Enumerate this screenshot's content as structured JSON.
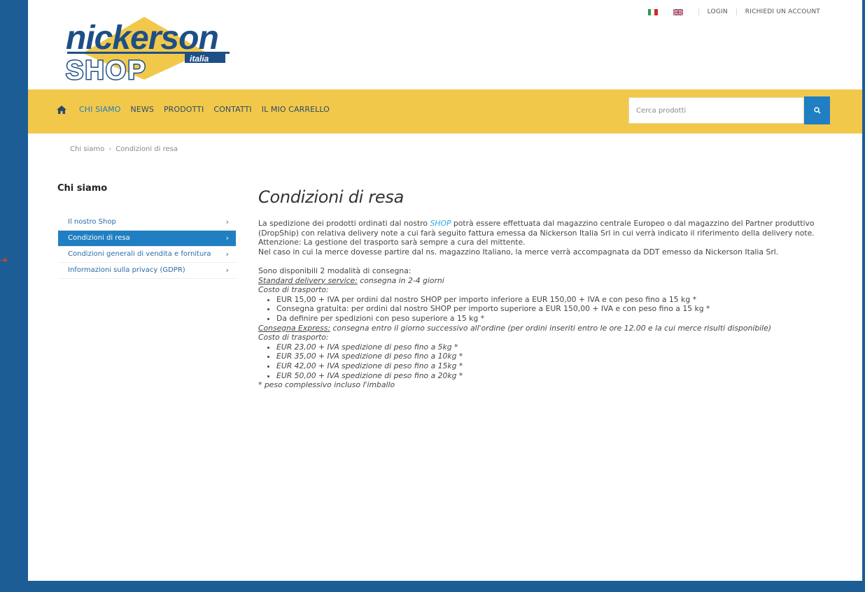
{
  "top_links": {
    "login": "LOGIN",
    "request_account": "RICHIEDI UN ACCOUNT"
  },
  "logo": {
    "line1": "nickerson",
    "line2": "SHOP",
    "tag": "italia"
  },
  "nav": {
    "items": [
      "CHI SIAMO",
      "NEWS",
      "PRODOTTI",
      "CONTATTI",
      "IL MIO CARRELLO"
    ],
    "active_index": 0
  },
  "search": {
    "placeholder": "Cerca prodotti"
  },
  "breadcrumb": [
    "Chi siamo",
    "Condizioni di resa"
  ],
  "sidebar": {
    "title": "Chi siamo",
    "items": [
      {
        "label": "Il nostro Shop"
      },
      {
        "label": "Condizioni di resa"
      },
      {
        "label": "Condizioni generali di vendita e fornitura"
      },
      {
        "label": "Informazioni sulla privacy (GDPR)"
      }
    ],
    "active_index": 1
  },
  "content": {
    "title": "Condizioni di resa",
    "p1_a": "La spedizione dei prodotti ordinati dal nostro ",
    "p1_shop": "SHOP",
    "p1_b": " potrà essere effettuata dal magazzino centrale Europeo o dal magazzino del Partner produttivo (DropShip) con relativa delivery note a cui farà seguito fattura emessa da Nickerson Italia Srl in cui verrà indicato il riferimento della delivery note.",
    "attention": "Attenzione: La gestione del trasporto sarà sempre a cura del mittente.",
    "p2": "Nel caso in cui la merce dovesse partire dal ns. magazzino Italiano, la merce verrà accompagnata da DDT emesso da Nickerson Italia Srl.",
    "modes_intro": "Sono disponibili 2 modalità di consegna:",
    "standard_link": "Standard delivery service:",
    "standard_desc": " consegna in 2-4 giorni",
    "cost_label": "Costo di trasporto:",
    "standard_items": [
      "EUR 15,00 + IVA per ordini dal nostro SHOP per importo inferiore a EUR 150,00 + IVA e con peso fino a 15 kg *",
      "Consegna gratuita: per ordini dal nostro SHOP per importo superiore a EUR 150,00 + IVA e con peso fino a 15 kg *",
      "Da definire per spedizioni con peso superiore a 15 kg *"
    ],
    "express_link": "Consegna Express:",
    "express_desc": " consegna entro il giorno successivo all'ordine (per ordini inseriti entro le ore 12.00 e la cui merce risulti disponibile)",
    "express_items": [
      "EUR 23,00 + IVA spedizione di peso fino a 5kg *",
      "EUR 35,00 + IVA spedizione di peso fino a 10kg *",
      "EUR 42,00 + IVA spedizione di peso fino a 15kg *",
      "EUR 50,00 + IVA spedizione di peso fino a 20kg *"
    ],
    "footnote": "* peso complessivo incluso l'imballo"
  },
  "colors": {
    "nav_bg": "#f2c84b",
    "accent_blue": "#1f7fc2",
    "frame_blue": "#1d5d96",
    "link_blue": "#29a7e8"
  }
}
